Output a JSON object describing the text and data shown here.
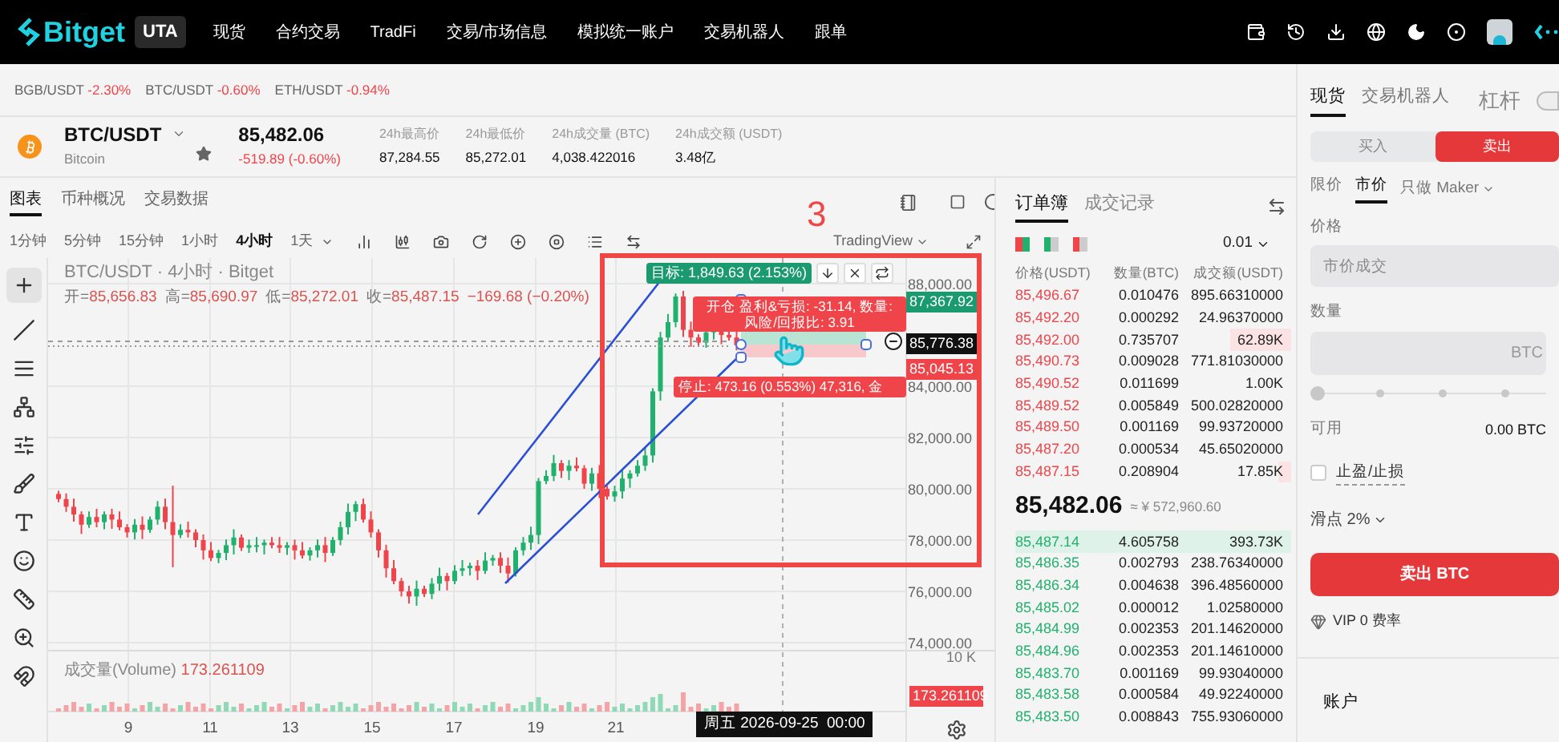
{
  "nav": {
    "brand": "Bitget",
    "badge": "UTA",
    "items": [
      "现货",
      "合约交易",
      "TradFi",
      "交易/市场信息",
      "模拟统一账户",
      "交易机器人",
      "跟单"
    ]
  },
  "favorites": [
    {
      "pair": "BGB/USDT",
      "change": "-2.30%"
    },
    {
      "pair": "BTC/USDT",
      "change": "-0.60%"
    },
    {
      "pair": "ETH/USDT",
      "change": "-0.94%"
    }
  ],
  "symbol": {
    "pair": "BTC/USDT",
    "name": "Bitcoin",
    "price": "85,482.06",
    "change": "-519.89 (-0.60%)",
    "stats": [
      {
        "label": "24h最高价",
        "value": "87,284.55"
      },
      {
        "label": "24h最低价",
        "value": "85,272.01"
      },
      {
        "label": "24h成交量 (BTC)",
        "value": "4,038.422016"
      },
      {
        "label": "24h成交额 (USDT)",
        "value": "3.48亿"
      }
    ]
  },
  "chart_tabs": [
    {
      "label": "图表",
      "selected": true
    },
    {
      "label": "币种概况",
      "selected": false
    },
    {
      "label": "交易数据",
      "selected": false
    }
  ],
  "intervals": [
    {
      "label": "1分钟",
      "selected": false
    },
    {
      "label": "5分钟",
      "selected": false
    },
    {
      "label": "15分钟",
      "selected": false
    },
    {
      "label": "1小时",
      "selected": false
    },
    {
      "label": "4小时",
      "selected": true
    },
    {
      "label": "1天",
      "selected": false
    }
  ],
  "chart_source": "TradingView",
  "legend": {
    "title": "BTC/USDT · 4小时 · Bitget",
    "ohlc": [
      {
        "label": "开=",
        "value": "85,656.83"
      },
      {
        "label": "高=",
        "value": "85,690.97"
      },
      {
        "label": "低=",
        "value": "85,272.01"
      },
      {
        "label": "收=",
        "value": "85,487.15"
      }
    ],
    "change": "−169.68 (−0.20%)"
  },
  "volume": {
    "label": "成交量(Volume)",
    "value": "173.261109",
    "axis_label": "10 K",
    "tag": "173.261109"
  },
  "price_axis": [
    "88,000.00",
    "84,000.00",
    "82,000.00",
    "80,000.00",
    "78,000.00",
    "76,000.00",
    "74,000.00"
  ],
  "price_tags": [
    {
      "label": "87,367.92",
      "kind": "target"
    },
    {
      "label": "85,776.38",
      "kind": "current"
    },
    {
      "label": "85,045.13",
      "kind": "stop"
    }
  ],
  "overlay": {
    "target": "目标: 1,849.63 (2.153%)",
    "entry": [
      "开仓 盈利&亏损: -31.14, 数量:",
      "风险/回报比: 3.91"
    ],
    "stop": "停止: 473.16 (0.553%) 47,316, 金"
  },
  "time_axis": [
    "9",
    "11",
    "13",
    "15",
    "17",
    "19",
    "21"
  ],
  "crosshair_time": "周五 2026-09-25  00:00",
  "annotation": {
    "label": "3"
  },
  "orderbook": {
    "tabs": [
      {
        "label": "订单簿",
        "selected": true
      },
      {
        "label": "成交记录",
        "selected": false
      }
    ],
    "step": "0.01",
    "columns": [
      "价格(USDT)",
      "数量(BTC)",
      "成交额(USDT)"
    ],
    "asks": [
      {
        "price": "85,496.67",
        "amount": "0.010476",
        "total": "895.66310000",
        "kind": "plain"
      },
      {
        "price": "85,492.20",
        "amount": "0.000292",
        "total": "24.96370000",
        "kind": "plain"
      },
      {
        "price": "85,492.00",
        "amount": "0.735707",
        "total": "62.89K",
        "kind": "medium"
      },
      {
        "price": "85,490.73",
        "amount": "0.009028",
        "total": "771.81030000",
        "kind": "plain"
      },
      {
        "price": "85,490.52",
        "amount": "0.011699",
        "total": "1.00K",
        "kind": "plain"
      },
      {
        "price": "85,489.52",
        "amount": "0.005849",
        "total": "500.02820000",
        "kind": "plain"
      },
      {
        "price": "85,489.50",
        "amount": "0.001169",
        "total": "99.93720000",
        "kind": "plain"
      },
      {
        "price": "85,487.20",
        "amount": "0.000534",
        "total": "45.65020000",
        "kind": "plain"
      },
      {
        "price": "85,487.15",
        "amount": "0.208904",
        "total": "17.85K",
        "kind": "shallow"
      }
    ],
    "last_price": "85,482.06",
    "last_fiat": "≈ ¥ 572,960.60",
    "bids": [
      {
        "price": "85,487.14",
        "amount": "4.605758",
        "total": "393.73K",
        "kind": "deep"
      },
      {
        "price": "85,486.35",
        "amount": "0.002793",
        "total": "238.76340000",
        "kind": "plain"
      },
      {
        "price": "85,486.34",
        "amount": "0.004638",
        "total": "396.48560000",
        "kind": "plain"
      },
      {
        "price": "85,485.02",
        "amount": "0.000012",
        "total": "1.02580000",
        "kind": "plain"
      },
      {
        "price": "85,484.99",
        "amount": "0.002353",
        "total": "201.14620000",
        "kind": "plain"
      },
      {
        "price": "85,484.96",
        "amount": "0.002353",
        "total": "201.14610000",
        "kind": "plain"
      },
      {
        "price": "85,483.70",
        "amount": "0.001169",
        "total": "99.93040000",
        "kind": "plain"
      },
      {
        "price": "85,483.58",
        "amount": "0.000584",
        "total": "49.92240000",
        "kind": "plain"
      },
      {
        "price": "85,483.50",
        "amount": "0.008843",
        "total": "755.93060000",
        "kind": "plain"
      }
    ]
  },
  "trade": {
    "tabs": [
      {
        "label": "现货",
        "selected": true
      },
      {
        "label": "交易机器人",
        "selected": false
      }
    ],
    "leverage": {
      "label": "杠杆",
      "on": false
    },
    "sides": [
      {
        "label": "买入",
        "selected": false
      },
      {
        "label": "卖出",
        "selected": true
      }
    ],
    "order_types": [
      {
        "label": "限价",
        "selected": false
      },
      {
        "label": "市价",
        "selected": true
      }
    ],
    "maker_mode": "只做 Maker",
    "price_label": "价格",
    "price_placeholder": "市价成交",
    "qty_label": "数量",
    "qty_unit": "BTC",
    "slider": {
      "level": 0
    },
    "available_label": "可用",
    "available": "0.00 BTC",
    "tpsl": {
      "label": "止盈/止损",
      "checked": false
    },
    "slippage": "滑点 2%",
    "submit": "卖出 BTC",
    "vip": "VIP 0 费率",
    "account": "账户"
  }
}
